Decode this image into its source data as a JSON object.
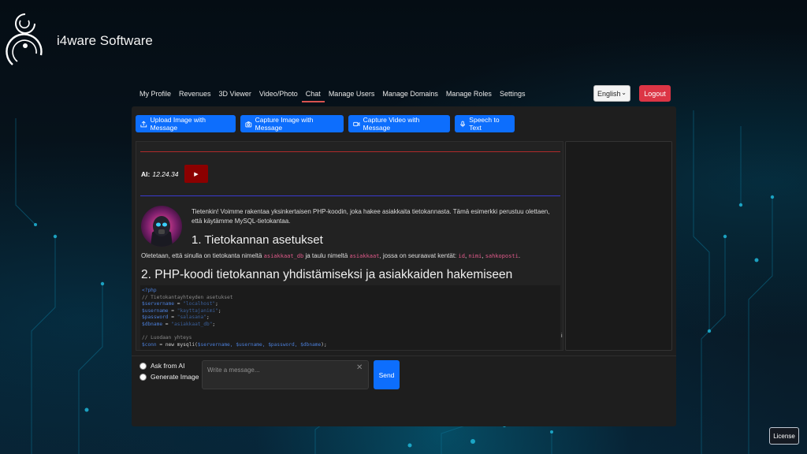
{
  "brand": {
    "name": "i4ware Software"
  },
  "nav": {
    "items": [
      {
        "label": "My Profile",
        "active": false
      },
      {
        "label": "Revenues",
        "active": false
      },
      {
        "label": "3D Viewer",
        "active": false
      },
      {
        "label": "Video/Photo",
        "active": false
      },
      {
        "label": "Chat",
        "active": true
      },
      {
        "label": "Manage Users",
        "active": false
      },
      {
        "label": "Manage Domains",
        "active": false
      },
      {
        "label": "Manage Roles",
        "active": false
      },
      {
        "label": "Settings",
        "active": false
      }
    ],
    "language": "English",
    "logout_label": "Logout"
  },
  "toolbar": {
    "upload_image": "Upload Image with Message",
    "capture_image": "Capture Image with Message",
    "capture_video": "Capture Video with Message",
    "speech_to_text": "Speech to Text"
  },
  "chat": {
    "ai_label": "AI:",
    "ai_time": "12.24.34",
    "play_icon": "▶",
    "intro": "Tietenkin! Voimme rakentaa yksinkertaisen PHP-koodin, joka hakee asiakkaita tietokannasta. Tämä esimerkki perustuu olettaen, että käytämme MySQL-tietokantaa.",
    "heading1": "1. Tietokannan asetukset",
    "para": {
      "t1": "Oletetaan, että sinulla on tietokanta nimeltä ",
      "c1": "asiakkaat_db",
      "t2": " ja taulu nimeltä ",
      "c2": "asiakkaat",
      "t3": ", jossa on seuraavat kentät: ",
      "c3": "id",
      "t4": ", ",
      "c4": "nimi",
      "t5": ", ",
      "c5": "sahkoposti",
      "t6": "."
    },
    "heading2": "2. PHP-koodi tietokannan yhdistämiseksi ja asiakkaiden hakemiseen",
    "code": {
      "line1": "<?php",
      "line2": "// Tietokantayhteyden asetukset",
      "line3_var": "$servername",
      "line3_val": "\"localhost\"",
      "line4_var": "$username",
      "line4_val": "\"kayttajanimi\"",
      "line5_var": "$password",
      "line5_val": "\"salasana\"",
      "line6_var": "$dbname",
      "line6_val": "\"asiakkaat_db\"",
      "line8": "// Luodaan yhteys",
      "line9_a": "$conn",
      "line9_b": " = new mysqli(",
      "line9_c": "$servername, $username, $password, $dbname",
      "line9_d": ");"
    },
    "scroll_indicator": "i"
  },
  "composer": {
    "option_ask": "Ask from AI",
    "option_generate": "Generate Image",
    "placeholder": "Write a message...",
    "clear_icon": "✕",
    "send_label": "Send"
  },
  "footer": {
    "license_label": "License"
  },
  "colors": {
    "primary": "#0d6efd",
    "danger": "#dc3545",
    "panel": "#1e1e1e"
  }
}
